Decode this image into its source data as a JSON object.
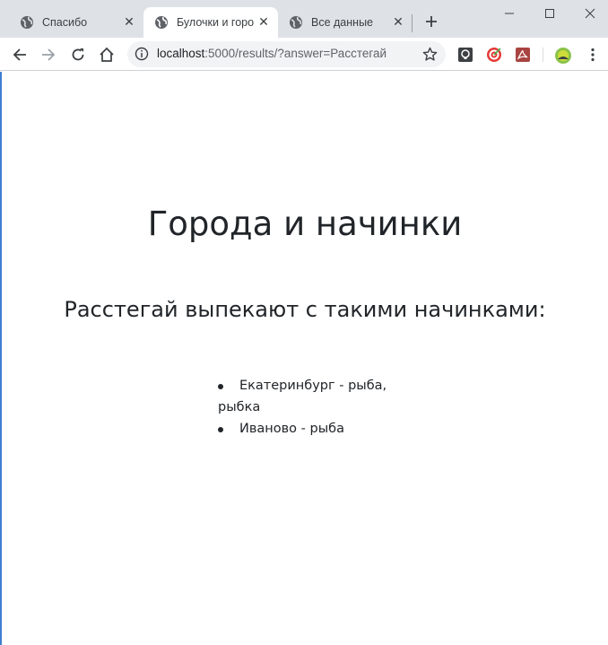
{
  "browser": {
    "tabs": [
      {
        "title": "Спасибо",
        "active": false
      },
      {
        "title": "Булочки и горо",
        "active": true
      },
      {
        "title": "Все данные",
        "active": false
      }
    ],
    "url_host": "localhost",
    "url_path": ":5000/results/?answer=Расстегай"
  },
  "page": {
    "title": "Города и начинки",
    "subtitle": "Расстегай выпекают с такими начинками:",
    "items": [
      {
        "line1": "Екатеринбург - рыба,",
        "line2": "рыбка"
      },
      {
        "line1": "Иваново - рыба",
        "line2": ""
      }
    ]
  }
}
